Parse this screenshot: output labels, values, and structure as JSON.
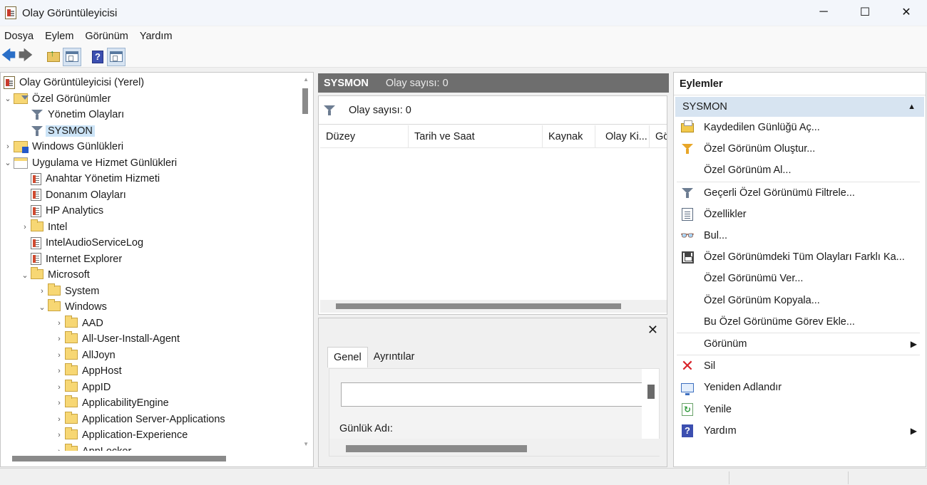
{
  "window": {
    "title": "Olay Görüntüleyicisi",
    "controls": {
      "minimize": "─",
      "maximize": "☐",
      "close": "✕"
    }
  },
  "menu": [
    "Dosya",
    "Eylem",
    "Görünüm",
    "Yardım"
  ],
  "toolbar": {
    "back": "🡄",
    "forward": "🡆",
    "help_glyph": "?"
  },
  "tree": [
    {
      "label": "Olay Görüntüleyicisi (Yerel)",
      "icon": "event-viewer-icon",
      "chev": ""
    },
    {
      "label": "Özel Görünümler",
      "icon": "folder-filter-icon",
      "chev": "⌄"
    },
    {
      "label": "Yönetim Olayları",
      "icon": "filter-icon",
      "chev": ""
    },
    {
      "label": "SYSMON",
      "icon": "filter-icon",
      "chev": "",
      "selected": true
    },
    {
      "label": "Windows Günlükleri",
      "icon": "windows-logs-icon",
      "chev": "›"
    },
    {
      "label": "Uygulama ve Hizmet Günlükleri",
      "icon": "app-logs-icon",
      "chev": "⌄"
    },
    {
      "label": "Anahtar Yönetim Hizmeti",
      "icon": "log-icon",
      "chev": ""
    },
    {
      "label": "Donanım Olayları",
      "icon": "log-icon",
      "chev": ""
    },
    {
      "label": "HP Analytics",
      "icon": "log-icon",
      "chev": ""
    },
    {
      "label": "Intel",
      "icon": "folder-icon",
      "chev": "›"
    },
    {
      "label": "IntelAudioServiceLog",
      "icon": "log-icon",
      "chev": ""
    },
    {
      "label": "Internet Explorer",
      "icon": "log-icon",
      "chev": ""
    },
    {
      "label": "Microsoft",
      "icon": "folder-icon",
      "chev": "⌄"
    },
    {
      "label": "System",
      "icon": "folder-icon",
      "chev": "›"
    },
    {
      "label": "Windows",
      "icon": "folder-icon",
      "chev": "⌄"
    },
    {
      "label": "AAD",
      "icon": "folder-icon",
      "chev": "›"
    },
    {
      "label": "All-User-Install-Agent",
      "icon": "folder-icon",
      "chev": "›"
    },
    {
      "label": "AllJoyn",
      "icon": "folder-icon",
      "chev": "›"
    },
    {
      "label": "AppHost",
      "icon": "folder-icon",
      "chev": "›"
    },
    {
      "label": "AppID",
      "icon": "folder-icon",
      "chev": "›"
    },
    {
      "label": "ApplicabilityEngine",
      "icon": "folder-icon",
      "chev": "›"
    },
    {
      "label": "Application Server-Applications",
      "icon": "folder-icon",
      "chev": "›"
    },
    {
      "label": "Application-Experience",
      "icon": "folder-icon",
      "chev": "›"
    },
    {
      "label": "AppLocker",
      "icon": "folder-icon",
      "chev": "›"
    }
  ],
  "middle": {
    "header_name": "SYSMON",
    "header_count": "Olay sayısı: 0",
    "filter_text": "Olay sayısı: 0",
    "columns": [
      "Düzey",
      "Tarih ve Saat",
      "Kaynak",
      "Olay Ki...",
      "Gö"
    ],
    "detail": {
      "close": "✕",
      "tabs": [
        "Genel",
        "Ayrıntılar"
      ],
      "log_name_label": "Günlük Adı:"
    }
  },
  "actions": {
    "title": "Eylemler",
    "group": "SYSMON",
    "group_arrow": "▲",
    "items": [
      {
        "label": "Kaydedilen Günlüğü Aç...",
        "icon": "open-log-icon"
      },
      {
        "label": "Özel Görünüm Oluştur...",
        "icon": "create-filter-icon"
      },
      {
        "label": "Özel Görünüm Al...",
        "icon": ""
      },
      {
        "label": "Geçerli Özel Görünümü Filtrele...",
        "icon": "filter-icon"
      },
      {
        "label": "Özellikler",
        "icon": "properties-icon"
      },
      {
        "label": "Bul...",
        "icon": "binoculars-icon"
      },
      {
        "label": "Özel Görünümdeki Tüm Olayları Farklı Ka...",
        "icon": "save-icon"
      },
      {
        "label": "Özel Görünümü Ver...",
        "icon": ""
      },
      {
        "label": "Özel Görünüm Kopyala...",
        "icon": ""
      },
      {
        "label": "Bu Özel Görünüme Görev Ekle...",
        "icon": ""
      },
      {
        "label": "Görünüm",
        "icon": "",
        "submenu": "▶"
      },
      {
        "label": "Sil",
        "icon": "delete-icon"
      },
      {
        "label": "Yeniden Adlandır",
        "icon": "rename-icon"
      },
      {
        "label": "Yenile",
        "icon": "refresh-icon"
      },
      {
        "label": "Yardım",
        "icon": "help-icon",
        "submenu": "▶"
      }
    ]
  }
}
